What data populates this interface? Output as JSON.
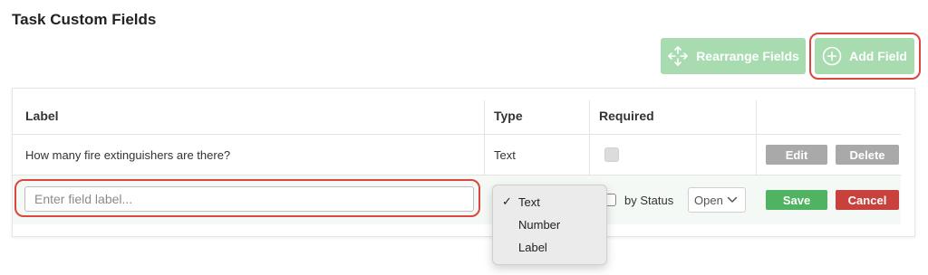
{
  "page": {
    "title": "Task Custom Fields"
  },
  "toolbar": {
    "rearrange_label": "Rearrange Fields",
    "add_field_label": "Add Field"
  },
  "table": {
    "columns": [
      "Label",
      "Type",
      "Required"
    ],
    "rows": [
      {
        "label": "How many fire extinguishers are there?",
        "type": "Text",
        "required": false,
        "edit_label": "Edit",
        "delete_label": "Delete"
      }
    ],
    "new_row": {
      "label_value": "",
      "label_placeholder": "Enter field label...",
      "by_status_label": "by Status",
      "status_value": "Open",
      "save_label": "Save",
      "cancel_label": "Cancel"
    }
  },
  "type_dropdown": {
    "options": [
      "Text",
      "Number",
      "Label"
    ],
    "selected": "Text",
    "check_mark": "✓"
  },
  "colors": {
    "accent_light_green": "#a9dbb1",
    "save_green": "#4fb361",
    "cancel_red": "#c9413d",
    "highlight_ring": "#d9473f",
    "disabled_grey": "#a9a9a9"
  },
  "icons": {
    "rearrange": "move-arrows-icon",
    "add": "plus-circle-icon",
    "select": "chevron-down-icon",
    "checked": "checkmark-icon"
  }
}
